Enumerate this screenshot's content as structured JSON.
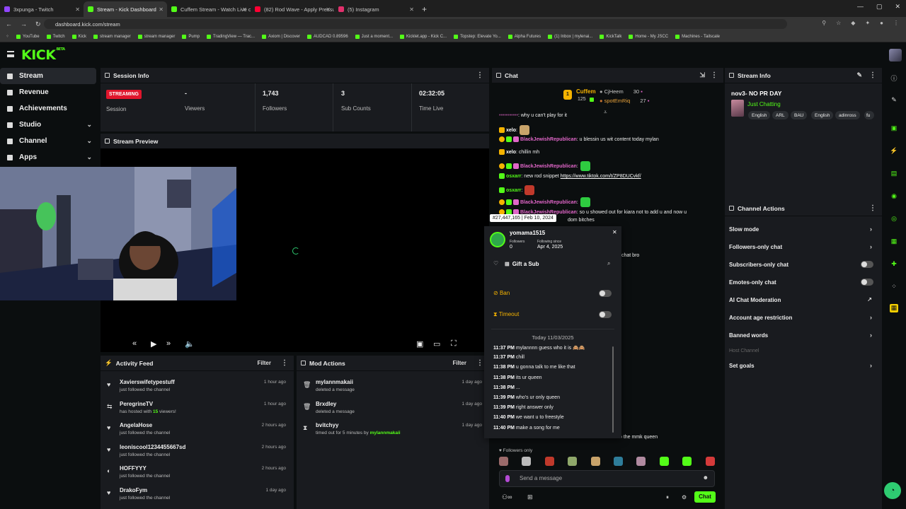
{
  "browser": {
    "tabs": [
      {
        "label": "3xpunga - Twitch",
        "color": "#9146ff"
      },
      {
        "label": "Stream - Kick Dashboard",
        "color": "#53fc18"
      },
      {
        "label": "Cuffem Stream - Watch Live on",
        "color": "#53fc18"
      },
      {
        "label": "(82) Rod Wave - Apply Pressure",
        "color": "#ff0033"
      },
      {
        "label": "(5) Instagram",
        "color": "#e1306c"
      }
    ],
    "url": "dashboard.kick.com/stream",
    "bookmarks": [
      "YouTube",
      "Twitch",
      "Kick",
      "stream manager",
      "stream manager",
      "Pump",
      "TradingView — Trac...",
      "Axiom | Discover",
      "AUDCAD 0.89596",
      "Just a moment...",
      "Kicklet.app - Kick C...",
      "Topstep: Elevate Yo...",
      "Alpha Futures",
      "(1) Inbox | mylenai...",
      "KickTalk",
      "Home - My JSCC",
      "Machines - Tailscale"
    ]
  },
  "brand": {
    "logo": "KICK",
    "beta": "BETA",
    "accent": "#53fc18"
  },
  "nav": {
    "items": [
      {
        "label": "Stream"
      },
      {
        "label": "Revenue"
      },
      {
        "label": "Achievements"
      },
      {
        "label": "Studio",
        "chev": "⌄"
      },
      {
        "label": "Channel",
        "chev": "⌄"
      },
      {
        "label": "Apps",
        "chev": "⌄"
      }
    ]
  },
  "session": {
    "title": "Session Info",
    "badge": "STREAMING",
    "session_label": "Session",
    "stats": [
      {
        "value": "-",
        "label": "Viewers"
      },
      {
        "value": "1,743",
        "label": "Followers"
      },
      {
        "value": "3",
        "label": "Sub Counts"
      },
      {
        "value": "02:32:05",
        "label": "Time Live"
      }
    ]
  },
  "preview": {
    "title": "Stream Preview"
  },
  "activity": {
    "title": "Activity Feed",
    "filter": "Filter",
    "items": [
      {
        "icon": "♥",
        "name": "Xavierswifetypestuff",
        "sub": "just followed the channel",
        "time": "1 hour ago"
      },
      {
        "icon": "⇆",
        "name": "PeregrineTV",
        "sub_pre": "has hosted with ",
        "sub_hl": "15",
        "sub_post": " viewers!",
        "time": "1 hour ago"
      },
      {
        "icon": "♥",
        "name": "AngelaHose",
        "sub": "just followed the channel",
        "time": "2 hours ago"
      },
      {
        "icon": "♥",
        "name": "leoniscool1234455667sd",
        "sub": "just followed the channel",
        "time": "2 hours ago"
      },
      {
        "icon": "◐",
        "name": "HOFFYYY",
        "sub": "just followed the channel",
        "time": "2 hours ago"
      },
      {
        "icon": "♥",
        "name": "DrakoFym",
        "sub": "just followed the channel",
        "time": "1 day ago"
      }
    ]
  },
  "mod": {
    "title": "Mod Actions",
    "filter": "Filter",
    "items": [
      {
        "icon": "🗑",
        "name": "mylannmakaii",
        "sub": "deleted a message",
        "time": "1 day ago"
      },
      {
        "icon": "🗑",
        "name": "Brxdley",
        "sub": "deleted a message",
        "time": "1 day ago"
      },
      {
        "icon": "⧗",
        "name": "bvitchyy",
        "sub_pre": "timed out for 5 minutes by ",
        "sub_hl": "mylannmakaii",
        "time": "1 day ago"
      }
    ]
  },
  "chat": {
    "title": "Chat",
    "leaderboard": {
      "first": {
        "name": "Cuffem",
        "count": "125",
        "rank": "1"
      },
      "second": {
        "name": "CjHeem",
        "count": "30"
      },
      "third": {
        "name": "spotEmRiq",
        "count": "27"
      }
    },
    "messages": [
      {
        "user": "",
        "text": ": why u can't play for it",
        "type": "plain"
      },
      {
        "user": "xelo",
        "text": ":",
        "type": "white-emote"
      },
      {
        "user": "BlackJewishRepublican",
        "text": ": u blessin us wit content today mylan",
        "type": "pink"
      },
      {
        "user": "xelo",
        "text": ": chillin mh",
        "type": "white"
      },
      {
        "user": "BlackJewishRepublican",
        "text": ":",
        "type": "pink-emote"
      },
      {
        "user": "osxarr",
        "text": ": new rod snippet ",
        "link": "https://www.tiktok.com/t/ZP8DUCvkf/",
        "type": "green-link"
      },
      {
        "user": "osxarr",
        "text": ":",
        "type": "green-emote"
      },
      {
        "user": "BlackJewishRepublican",
        "text": ":",
        "type": "pink-emote"
      },
      {
        "user": "BlackJewishRepublican",
        "text": ": so u showed out for kiara not to add u and now u",
        "type": "pink"
      },
      {
        "user": "",
        "text": "dom bitches",
        "type": "plain"
      }
    ],
    "hidden_tail": "chat bro",
    "tail_msg": "o the mmk queen",
    "followers_only": "Followers only",
    "placeholder": "Send a message",
    "send": "Chat"
  },
  "usercard": {
    "tooltip": "#27,447,165 | Feb 10, 2024",
    "username": "yomama1515",
    "followers_label": "Followers",
    "followers": "0",
    "following_label": "Following since",
    "following": "Apr 4, 2025",
    "gift": "Gift a Sub",
    "ban": "Ban",
    "timeout": "Timeout",
    "date_header": "Today 11/03/2025",
    "history": [
      {
        "time": "11:37 PM",
        "text": "mylannnn guess who it is 🙈🙈"
      },
      {
        "time": "11:37 PM",
        "text": "chill"
      },
      {
        "time": "11:38 PM",
        "text": "u gonna talk to me like that"
      },
      {
        "time": "11:38 PM",
        "text": "its ur queen"
      },
      {
        "time": "11:38 PM",
        "text": "..."
      },
      {
        "time": "11:39 PM",
        "text": "who's ur only queen"
      },
      {
        "time": "11:39 PM",
        "text": "right answer only"
      },
      {
        "time": "11:40 PM",
        "text": "we want u to freestyle"
      },
      {
        "time": "11:40 PM",
        "text": "make a song for me"
      }
    ]
  },
  "streaminfo": {
    "title": "Stream Info",
    "stream_title": "nov3- NO PR DAY",
    "category": "Just Chatting",
    "tags": [
      "English",
      "ARL",
      "BAU",
      "English",
      "adinross",
      "fu"
    ]
  },
  "actions": {
    "title": "Channel Actions",
    "items": [
      {
        "label": "Slow mode",
        "kind": "arrow"
      },
      {
        "label": "Followers-only chat",
        "kind": "arrow"
      },
      {
        "label": "Subscribers-only chat",
        "kind": "toggle"
      },
      {
        "label": "Emotes-only chat",
        "kind": "toggle"
      },
      {
        "label": "AI Chat Moderation",
        "kind": "external"
      },
      {
        "label": "Account age restriction",
        "kind": "arrow"
      },
      {
        "label": "Banned words",
        "kind": "arrow"
      },
      {
        "label": "Host Channel",
        "kind": "disabled"
      },
      {
        "label": "Set goals",
        "kind": "arrow"
      }
    ]
  }
}
